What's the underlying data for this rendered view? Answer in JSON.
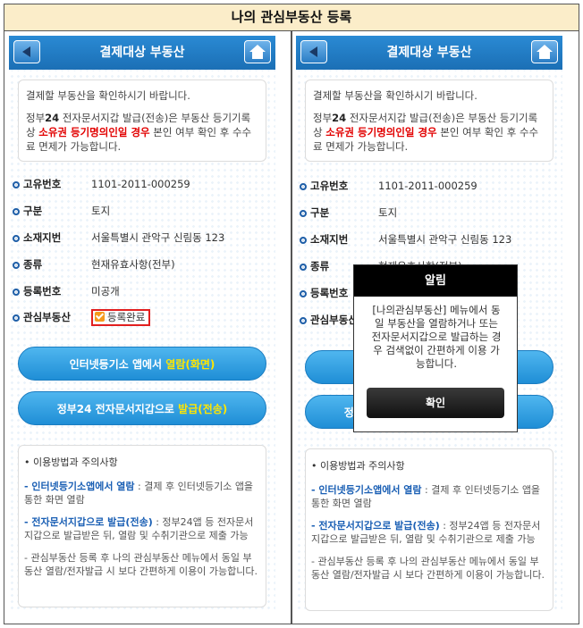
{
  "page_title": "나의 관심부동산 등록",
  "screen": {
    "header_title": "결제대상 부동산",
    "notice": {
      "line1": "결제할 부동산을 확인하시기 바랍니다.",
      "line2_a": "정부",
      "line2_b": "24",
      "line2_c": " 전자문서지갑 발급(전송)은 부동산 등기기록상 ",
      "line2_red": "소유권 등기명의인일 경우",
      "line2_d": " 본인 여부 확인 후 수수료 면제가 가능합니다."
    },
    "fields": [
      {
        "label": "고유번호",
        "value": "1101-2011-000259"
      },
      {
        "label": "구분",
        "value": "토지"
      },
      {
        "label": "소재지번",
        "value": "서울특별시 관악구 신림동 123"
      },
      {
        "label": "종류",
        "value": "현재유효사항(전부)"
      },
      {
        "label": "등록번호",
        "value": "미공개"
      },
      {
        "label": "관심부동산",
        "value": "등록완료"
      }
    ],
    "buttons": {
      "view_a": "인터넷등기소 앱에서 ",
      "view_b": "열람(화면)",
      "issue_a": "정부24 전자문서지갑으로 ",
      "issue_b": "발급(전송)"
    },
    "usage": {
      "heading": "• 이용방법과 주의사항",
      "item1_blue": "- 인터넷등기소앱에서 열람",
      "item1_rest": " : 결제 후 인터넷등기소 앱을 통한 화면 열람",
      "item2_blue": "- 전자문서지갑으로 발급(전송)",
      "item2_rest": " : 정부24앱 등 전자문서지갑으로 발급받은 뒤, 열람 및 수취기관으로 제출 가능",
      "item3": "- 관심부동산 등록 후 나의 관심부동산 메뉴에서 동일 부동산 열람/전자발급 시 보다 간편하게 이용이 가능합니다."
    }
  },
  "alert": {
    "title": "알림",
    "message": "[나의관심부동산] 메뉴에서 동일 부동산을 열람하거나 또는 전자문서지갑으로 발급하는 경우 검색없이 간편하게 이용 가능합니다.",
    "confirm": "확인"
  }
}
